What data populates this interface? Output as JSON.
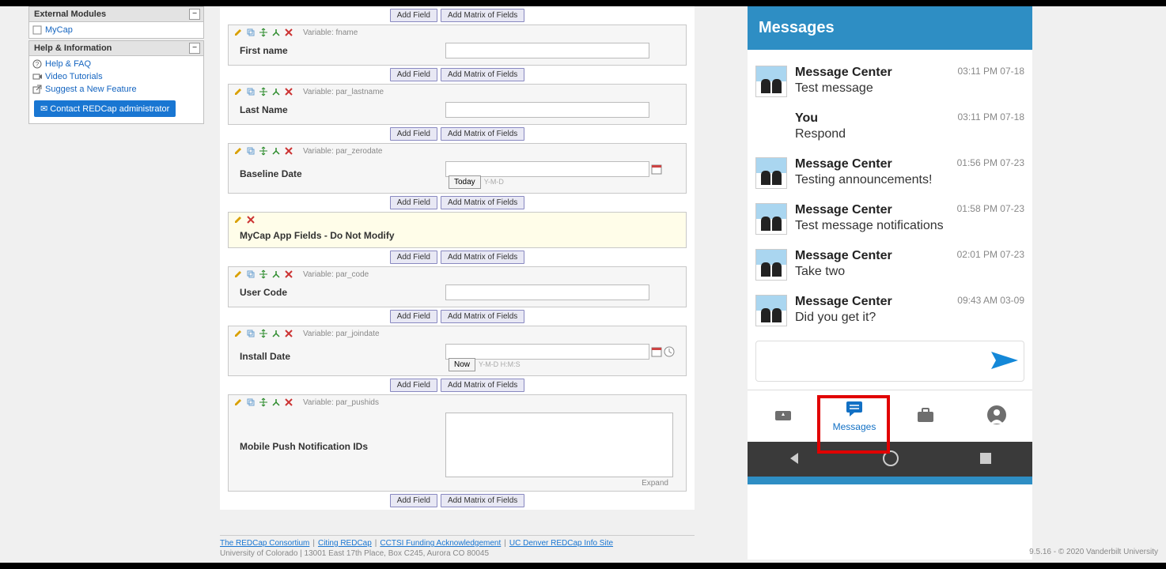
{
  "sidebar": {
    "external_modules": {
      "title": "External Modules",
      "items": [
        "MyCap"
      ]
    },
    "help": {
      "title": "Help & Information",
      "items": [
        "Help & FAQ",
        "Video Tutorials",
        "Suggest a New Feature"
      ],
      "contact_label": "Contact REDCap administrator"
    }
  },
  "buttons": {
    "add_field": "Add Field",
    "add_matrix": "Add Matrix of Fields"
  },
  "fields": [
    {
      "var_prefix": "Variable:",
      "var": "fname",
      "label": "First name",
      "type": "text"
    },
    {
      "var_prefix": "Variable:",
      "var": "par_lastname",
      "label": "Last Name",
      "type": "text"
    },
    {
      "var_prefix": "Variable:",
      "var": "par_zerodate",
      "label": "Baseline Date",
      "type": "date",
      "today": "Today",
      "hint": "Y-M-D"
    },
    {
      "label": "MyCap App Fields - Do Not Modify",
      "type": "header"
    },
    {
      "var_prefix": "Variable:",
      "var": "par_code",
      "label": "User Code",
      "type": "text"
    },
    {
      "var_prefix": "Variable:",
      "var": "par_joindate",
      "label": "Install Date",
      "type": "datetime",
      "now": "Now",
      "hint": "Y-M-D H:M:S"
    },
    {
      "var_prefix": "Variable:",
      "var": "par_pushids",
      "label": "Mobile Push Notification IDs",
      "type": "textarea",
      "expand": "Expand"
    }
  ],
  "footer": {
    "links": [
      "The REDCap Consortium",
      "Citing REDCap",
      "CCTSI Funding Acknowledgement",
      "UC Denver REDCap Info Site"
    ],
    "address": "University of Colorado | 13001 East 17th Place, Box C245, Aurora CO 80045"
  },
  "phone": {
    "header": "Messages",
    "messages": [
      {
        "sender": "Message Center",
        "text": "Test message",
        "time": "03:11 PM 07-18",
        "avatar": true
      },
      {
        "sender": "You",
        "text": "Respond",
        "time": "03:11 PM 07-18",
        "avatar": false
      },
      {
        "sender": "Message Center",
        "text": "Testing announcements!",
        "time": "01:56 PM 07-23",
        "avatar": true
      },
      {
        "sender": "Message Center",
        "text": "Test message notifications",
        "time": "01:58 PM 07-23",
        "avatar": true
      },
      {
        "sender": "Message Center",
        "text": "Take two",
        "time": "02:01 PM 07-23",
        "avatar": true
      },
      {
        "sender": "Message Center",
        "text": "Did you get it?",
        "time": "09:43 AM 03-09",
        "avatar": true
      }
    ],
    "nav": {
      "messages_label": "Messages"
    }
  },
  "copyright": "9.5.16 - © 2020 Vanderbilt University"
}
